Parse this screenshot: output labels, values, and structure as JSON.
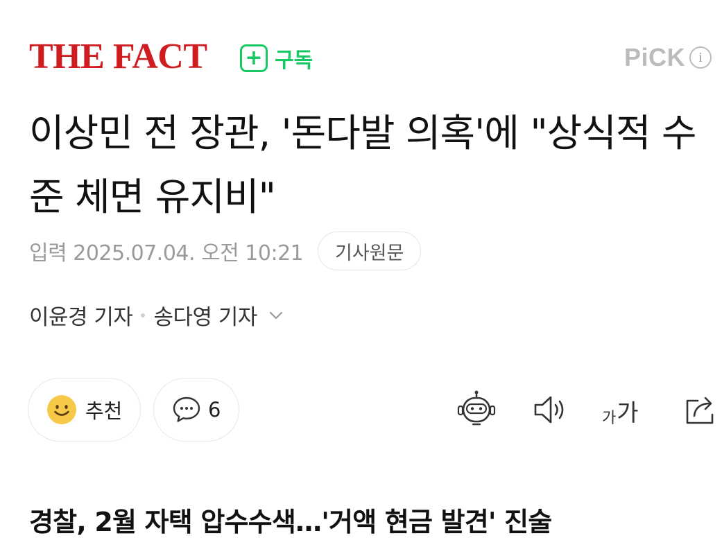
{
  "header": {
    "logo_text": "THE FACT",
    "subscribe_plus": "+",
    "subscribe_label": "구독",
    "pick_text": "PiCK",
    "pick_info": "i"
  },
  "article": {
    "headline": "이상민 전 장관, '돈다발 의혹'에 \"상식적 수준 체면 유지비\"",
    "date_text": "입력 2025.07.04. 오전 10:21",
    "original_button": "기사원문",
    "reporter_1": "이윤경 기자",
    "reporter_2": "송다영 기자",
    "subheading": "경찰, 2월 자택 압수수색…'거액 현금 발견' 진술"
  },
  "actions": {
    "like_label": "추천",
    "comment_count": "6",
    "font_small": "가",
    "font_large": "가"
  },
  "icons": {
    "subscribe": "plus-square-icon",
    "info": "info-circle-icon",
    "expand": "chevron-down-icon",
    "like": "smiley-face-icon",
    "comment": "speech-bubble-icon",
    "summary_bot": "robot-icon",
    "listen": "speaker-icon",
    "font_size": "font-size-icon",
    "share": "share-icon"
  },
  "colors": {
    "brand_red": "#cf1c20",
    "subscribe_green": "#17c964",
    "pick_gray": "#bcbcbc",
    "smiley_yellow": "#f7c948"
  }
}
